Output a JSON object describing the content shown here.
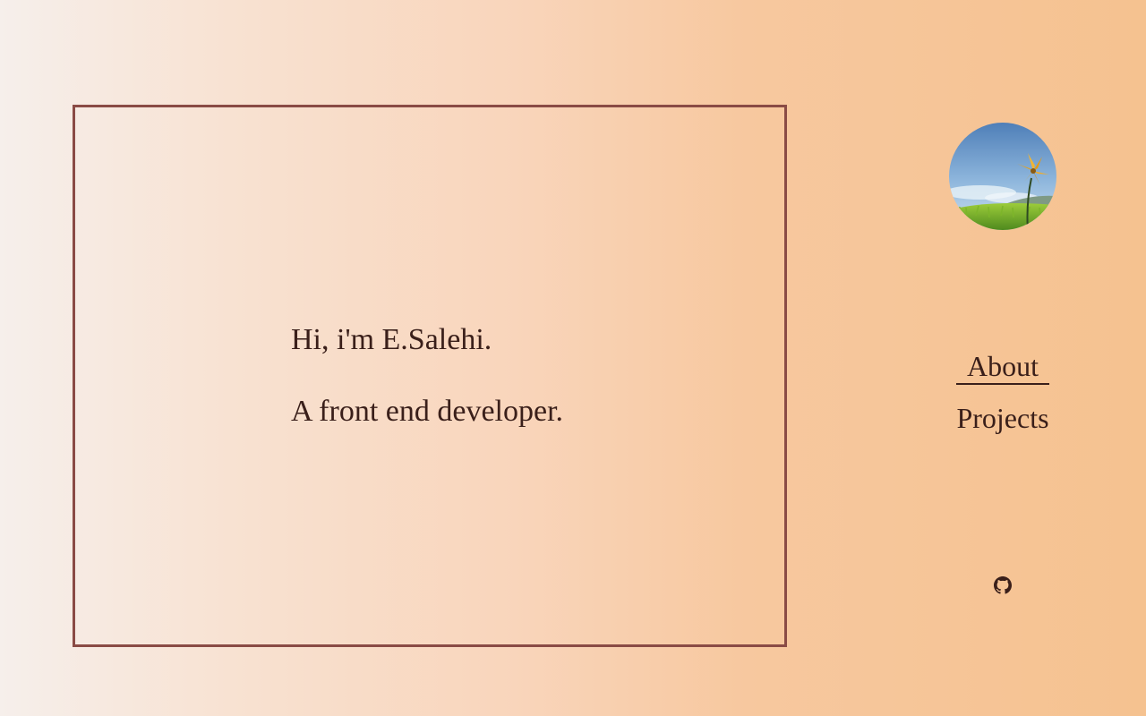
{
  "hero": {
    "greeting": "Hi, i'm E.Salehi.",
    "role": "A front end developer."
  },
  "avatar": {
    "icon": "flower-landscape-avatar"
  },
  "nav": {
    "items": [
      {
        "label": "About",
        "active": true
      },
      {
        "label": "Projects",
        "active": false
      }
    ]
  },
  "social": {
    "github_icon": "github-icon"
  },
  "colors": {
    "text": "#3a1f1a",
    "frame_border": "#8a4b45",
    "gradient_start": "#f6efeb",
    "gradient_end": "#f5c290"
  }
}
